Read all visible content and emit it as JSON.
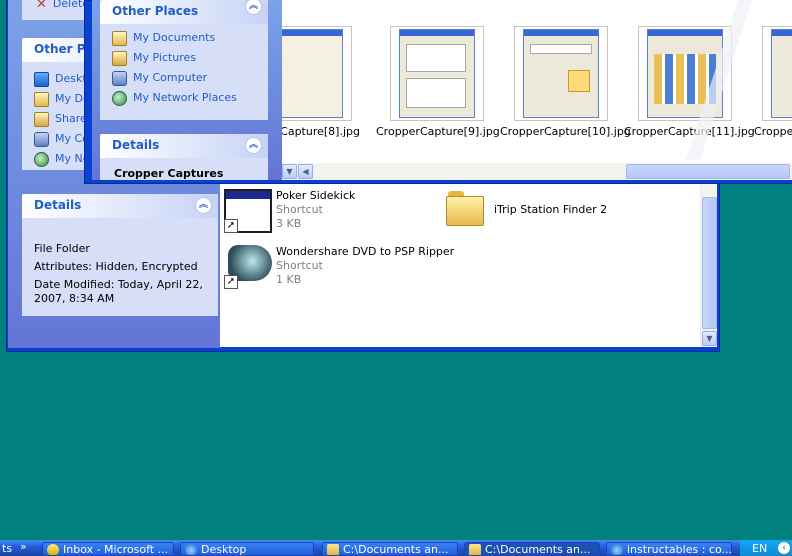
{
  "back_window": {
    "tasks_top_item": "Delete",
    "other_places": {
      "title": "Other Places",
      "items": [
        "Desktop",
        "My Documents",
        "Shared Documents",
        "My Computer",
        "My Network Places"
      ]
    },
    "details": {
      "title": "Details",
      "type": "File Folder",
      "attributes": "Attributes: Hidden, Encrypted",
      "modified_line1": "Date Modified: Today, April 22,",
      "modified_line2": "2007, 8:34 AM"
    },
    "files": [
      {
        "name": "Poker Sidekick",
        "type": "Shortcut",
        "size": "3 KB"
      },
      {
        "name": "iTrip Station Finder 2"
      },
      {
        "name": "Wondershare DVD to PSP Ripper",
        "type": "Shortcut",
        "size": "1 KB"
      }
    ]
  },
  "front_window": {
    "other_places": {
      "title": "Other Places",
      "items": [
        "My Documents",
        "My Pictures",
        "My Computer",
        "My Network Places"
      ]
    },
    "details": {
      "title": "Details",
      "name": "Cropper Captures"
    },
    "thumbnails": [
      "Capture[8].jpg",
      "CropperCapture[9].jpg",
      "CropperCapture[10].jpg",
      "CropperCapture[11].jpg",
      "Cropper"
    ]
  },
  "taskbar": {
    "start_fragment": "ts",
    "chevron": "»",
    "buttons": [
      "Inbox - Microsoft ...",
      "Desktop",
      "C:\\Documents an...",
      "C:\\Documents an...",
      "instructables : co..."
    ],
    "language": "EN"
  },
  "colors": {
    "desktop": "#00807f",
    "task_link": "#215dc6",
    "window_frame": "#0842d1"
  }
}
